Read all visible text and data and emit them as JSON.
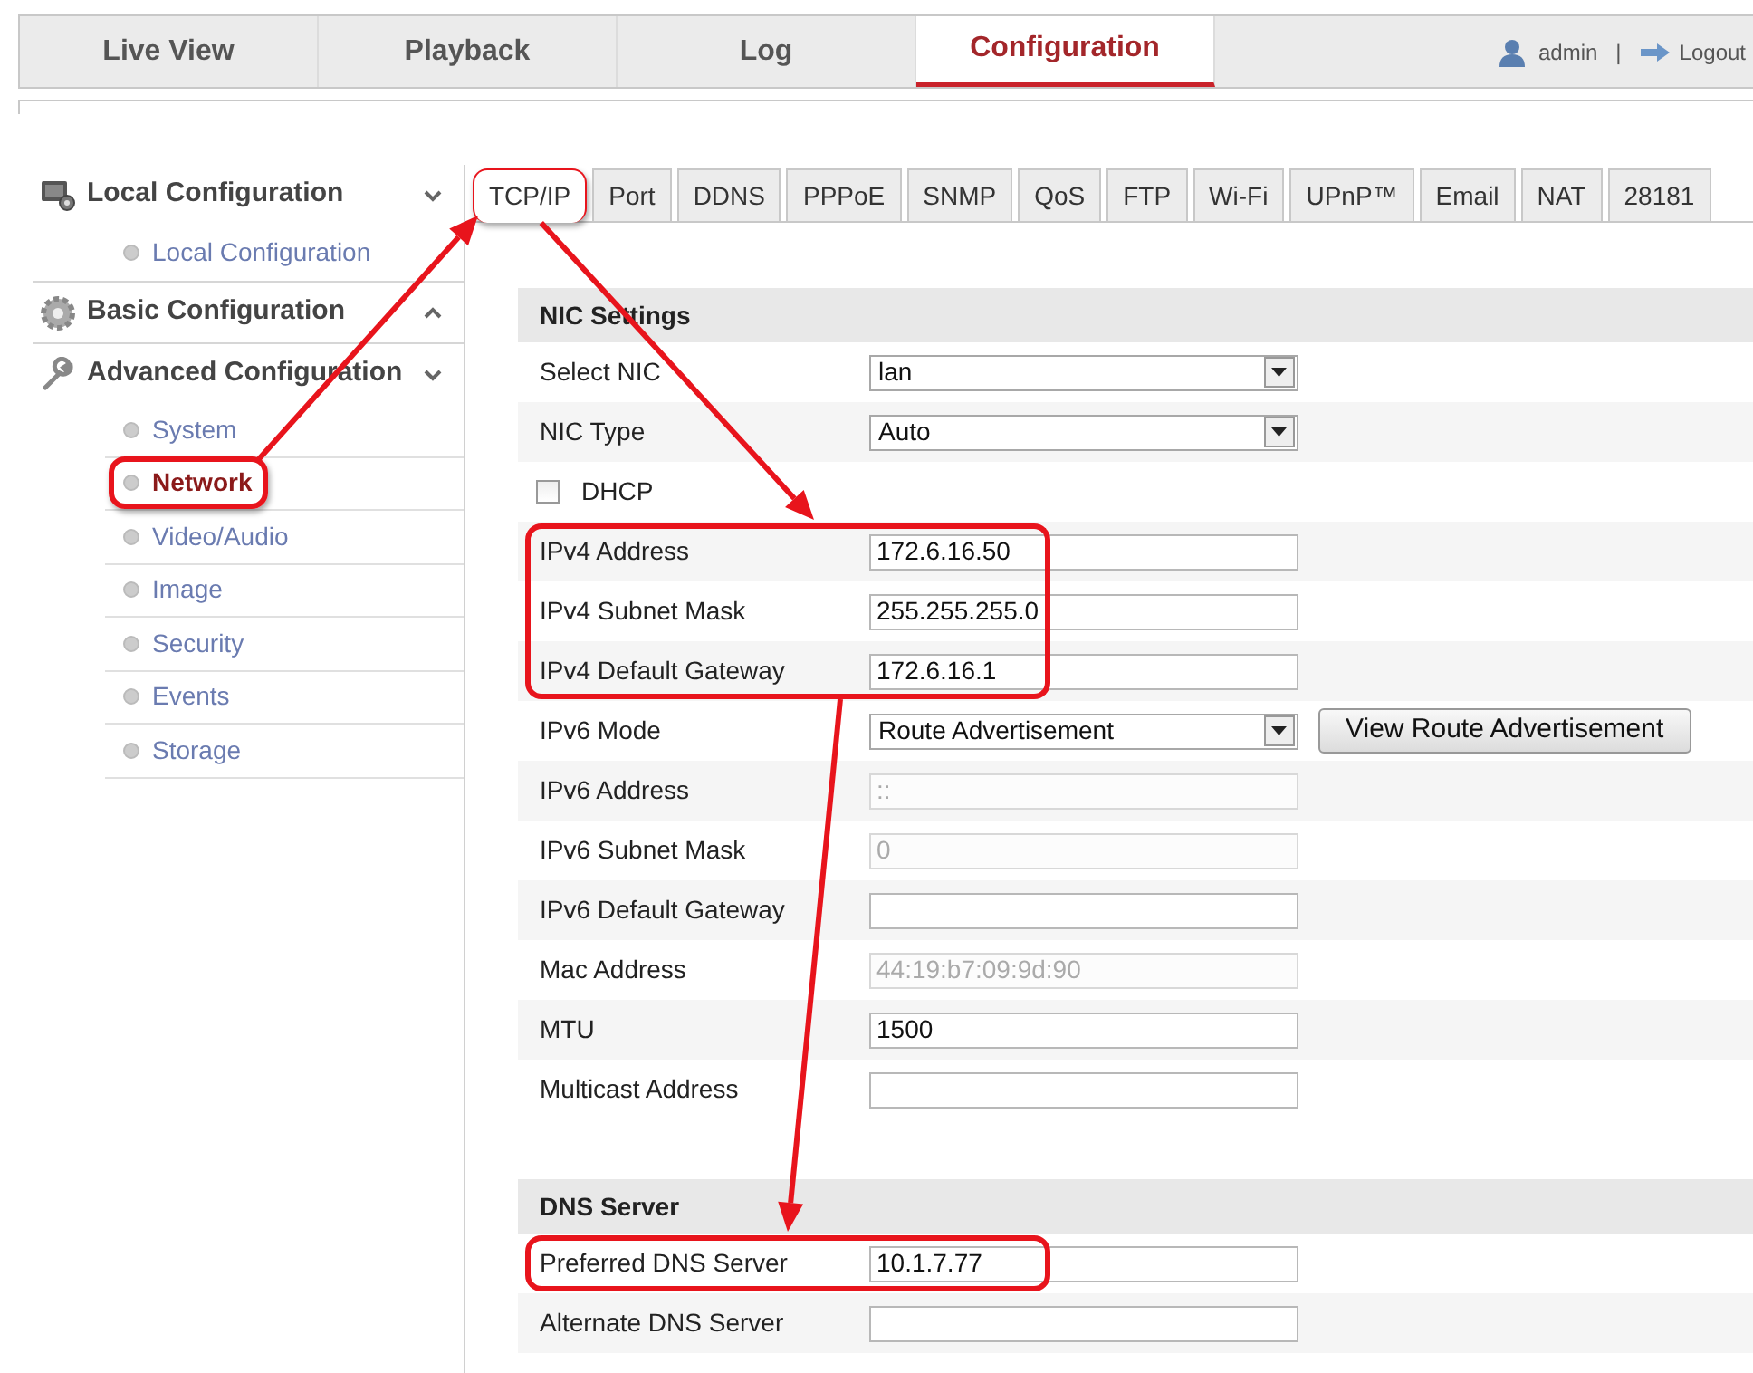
{
  "top_nav": {
    "tabs": [
      {
        "label": "Live View",
        "selected": false
      },
      {
        "label": "Playback",
        "selected": false
      },
      {
        "label": "Log",
        "selected": false
      },
      {
        "label": "Configuration",
        "selected": true
      }
    ],
    "user": "admin",
    "separator": "|",
    "logout": "Logout"
  },
  "sidebar": {
    "groups": [
      {
        "kind": "local",
        "label": "Local Configuration",
        "expanded": true,
        "children": [
          {
            "label": "Local Configuration",
            "selected": false,
            "highlighted": false
          }
        ]
      },
      {
        "kind": "basic",
        "label": "Basic Configuration",
        "expanded": false
      },
      {
        "kind": "advanced",
        "label": "Advanced Configuration",
        "expanded": true,
        "children": [
          {
            "label": "System",
            "selected": false,
            "highlighted": false
          },
          {
            "label": "Network",
            "selected": true,
            "highlighted": true
          },
          {
            "label": "Video/Audio",
            "selected": false,
            "highlighted": false
          },
          {
            "label": "Image",
            "selected": false,
            "highlighted": false
          },
          {
            "label": "Security",
            "selected": false,
            "highlighted": false
          },
          {
            "label": "Events",
            "selected": false,
            "highlighted": false
          },
          {
            "label": "Storage",
            "selected": false,
            "highlighted": false
          }
        ]
      }
    ]
  },
  "tabs": [
    {
      "label": "TCP/IP",
      "selected": true,
      "highlighted": true
    },
    {
      "label": "Port",
      "selected": false,
      "highlighted": false
    },
    {
      "label": "DDNS",
      "selected": false,
      "highlighted": false
    },
    {
      "label": "PPPoE",
      "selected": false,
      "highlighted": false
    },
    {
      "label": "SNMP",
      "selected": false,
      "highlighted": false
    },
    {
      "label": "QoS",
      "selected": false,
      "highlighted": false
    },
    {
      "label": "FTP",
      "selected": false,
      "highlighted": false
    },
    {
      "label": "Wi-Fi",
      "selected": false,
      "highlighted": false
    },
    {
      "label": "UPnP™",
      "selected": false,
      "highlighted": false
    },
    {
      "label": "Email",
      "selected": false,
      "highlighted": false
    },
    {
      "label": "NAT",
      "selected": false,
      "highlighted": false
    },
    {
      "label": "28181",
      "selected": false,
      "highlighted": false
    }
  ],
  "sections": [
    {
      "title": "NIC Settings",
      "rows": [
        {
          "kind": "select",
          "label": "Select NIC",
          "value": "lan",
          "highlighted": false
        },
        {
          "kind": "select",
          "label": "NIC Type",
          "value": "Auto",
          "highlighted": false
        },
        {
          "kind": "checkbox",
          "label": "DHCP",
          "checked": false,
          "highlighted": false
        },
        {
          "kind": "text",
          "label": "IPv4 Address",
          "value": "172.6.16.50",
          "disabled": false,
          "highlighted": true
        },
        {
          "kind": "text",
          "label": "IPv4 Subnet Mask",
          "value": "255.255.255.0",
          "disabled": false,
          "highlighted": true
        },
        {
          "kind": "text",
          "label": "IPv4 Default Gateway",
          "value": "172.6.16.1",
          "disabled": false,
          "highlighted": true
        },
        {
          "kind": "select",
          "label": "IPv6 Mode",
          "value": "Route Advertisement",
          "button": "View Route Advertisement",
          "highlighted": false
        },
        {
          "kind": "text",
          "label": "IPv6 Address",
          "value": "::",
          "disabled": true,
          "highlighted": false
        },
        {
          "kind": "text",
          "label": "IPv6 Subnet Mask",
          "value": "0",
          "disabled": true,
          "highlighted": false
        },
        {
          "kind": "text",
          "label": "IPv6 Default Gateway",
          "value": "",
          "disabled": false,
          "highlighted": false
        },
        {
          "kind": "text",
          "label": "Mac Address",
          "value": "44:19:b7:09:9d:90",
          "disabled": true,
          "highlighted": false
        },
        {
          "kind": "text",
          "label": "MTU",
          "value": "1500",
          "disabled": false,
          "highlighted": false
        },
        {
          "kind": "text",
          "label": "Multicast Address",
          "value": "",
          "disabled": false,
          "highlighted": false
        }
      ]
    },
    {
      "title": "DNS Server",
      "rows": [
        {
          "kind": "text",
          "label": "Preferred DNS Server",
          "value": "10.1.7.77",
          "disabled": false,
          "highlighted": true
        },
        {
          "kind": "text",
          "label": "Alternate DNS Server",
          "value": "",
          "disabled": false,
          "highlighted": false
        }
      ]
    }
  ],
  "callout_arrows": true
}
